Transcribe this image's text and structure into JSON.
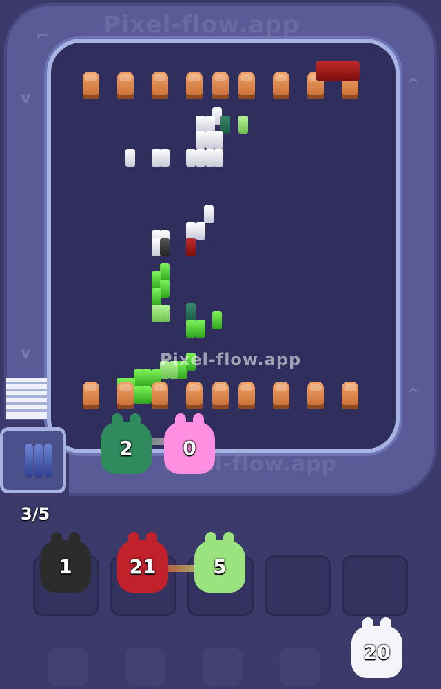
{
  "watermark": "Pixel-flow.app",
  "track_watermark": "Pixel-flow.app",
  "conveyor_watermark": "Pixel-flow.app",
  "progress": {
    "current": 3,
    "total": 5,
    "label": "3/5"
  },
  "conveyor_critters": [
    {
      "count": "2",
      "color": "#2f8a5d"
    },
    {
      "count": "0",
      "color": "#ff8fe0"
    }
  ],
  "slots": [
    {
      "count": "1",
      "color": "#2c2c2c"
    },
    {
      "count": "21",
      "color": "#c0212a"
    },
    {
      "count": "5",
      "color": "#9be37e"
    },
    {
      "count": "",
      "color": ""
    },
    {
      "count": "",
      "color": ""
    }
  ],
  "queue": [
    {
      "count": "20",
      "color": "#f4f4fa"
    }
  ],
  "colors": {
    "background": "#3b3a6b",
    "board": "#2f2e5c",
    "track": "#5a5a96",
    "peg": "#e08a4d"
  }
}
